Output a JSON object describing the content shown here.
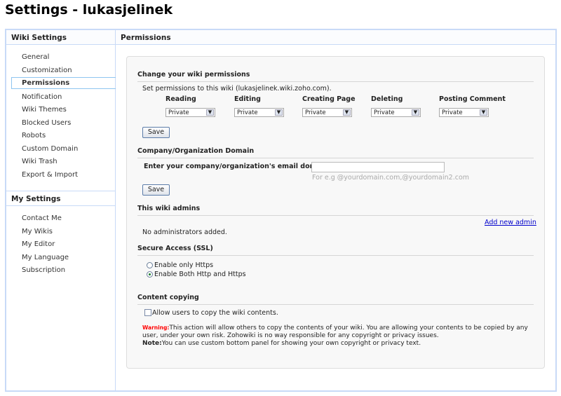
{
  "title": "Settings - lukasjelinek",
  "sidebar": {
    "header": "Wiki Settings",
    "items": [
      "General",
      "Customization",
      "Permissions",
      "Notification",
      "Wiki Themes",
      "Blocked Users",
      "Robots",
      "Custom Domain",
      "Wiki Trash",
      "Export & Import"
    ],
    "selected": "Permissions",
    "my_header": "My Settings",
    "my_items": [
      "Contact Me",
      "My Wikis",
      "My Editor",
      "My Language",
      "Subscription"
    ]
  },
  "main": {
    "header": "Permissions",
    "perm": {
      "title": "Change your wiki permissions",
      "desc": "Set permissions to this wiki (lukasjelinek.wiki.zoho.com).",
      "columns": [
        {
          "label": "Reading",
          "value": "Private"
        },
        {
          "label": "Editing",
          "value": "Private"
        },
        {
          "label": "Creating Page",
          "value": "Private"
        },
        {
          "label": "Deleting",
          "value": "Private"
        },
        {
          "label": "Posting Comment",
          "value": "Private"
        }
      ],
      "save": "Save"
    },
    "domain": {
      "title": "Company/Organization Domain",
      "label": "Enter your company/organization's email domains",
      "value": "",
      "hint": "For e.g @yourdomain.com,@yourdomain2.com",
      "save": "Save"
    },
    "admins": {
      "title": "This wiki admins",
      "add_link": "Add new admin",
      "empty": "No administrators added."
    },
    "ssl": {
      "title": "Secure Access (SSL)",
      "options": [
        {
          "label": "Enable only Https",
          "checked": false
        },
        {
          "label": "Enable Both Http and Https",
          "checked": true
        }
      ]
    },
    "copy": {
      "title": "Content copying",
      "checkbox": "Allow users to copy the wiki contents.",
      "checked": false,
      "warning_label": "Warning:",
      "warning": "This action will allow others to copy the contents of your wiki. You are allowing your contents to be copied by any user, under your own risk. Zohowiki is no way responsible for any copyright or privacy issues.",
      "note_label": "Note:",
      "note": "You can use custom bottom panel for showing your own copyright or privacy text."
    }
  },
  "colors": {
    "frame": "#c8daf7",
    "warning": "#ff0000",
    "link": "#0000cc"
  }
}
